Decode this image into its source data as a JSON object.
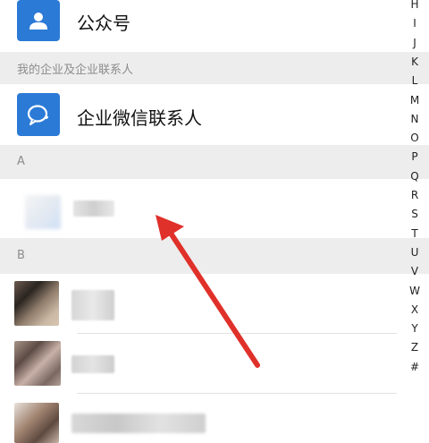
{
  "entries": {
    "official_accounts": "公众号",
    "enterprise_wechat": "企业微信联系人"
  },
  "sections": {
    "enterprise_header": "我的企业及企业联系人",
    "a": "A",
    "b": "B"
  },
  "index_letters": [
    "H",
    "I",
    "J",
    "K",
    "L",
    "M",
    "N",
    "O",
    "P",
    "Q",
    "R",
    "S",
    "T",
    "U",
    "V",
    "W",
    "X",
    "Y",
    "Z",
    "#"
  ],
  "colors": {
    "accent": "#2b7ad6",
    "arrow": "#e0302a",
    "section_bg": "#ededed"
  },
  "icons": {
    "official_accounts": "person-icon",
    "enterprise_wechat": "chat-bubble-icon"
  }
}
